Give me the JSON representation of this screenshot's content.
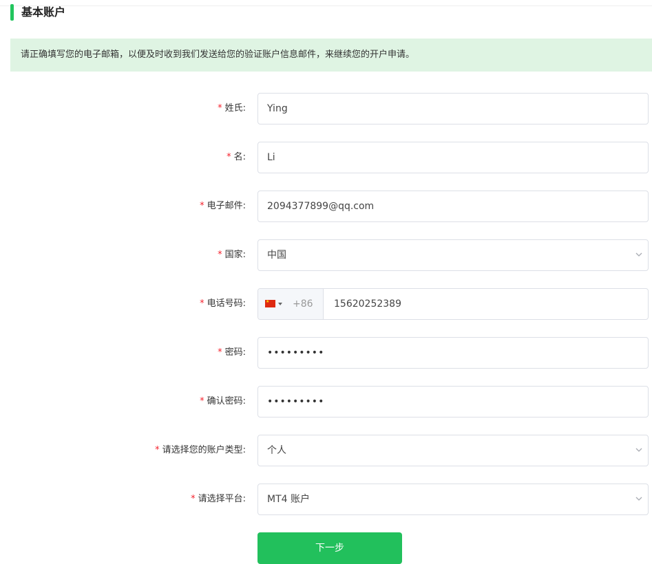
{
  "section": {
    "title": "基本账户"
  },
  "notice": {
    "text": "请正确填写您的电子邮箱，以便及时收到我们发送给您的验证账户信息邮件，来继续您的开户申请。"
  },
  "required_mark": "*",
  "form": {
    "last_name": {
      "label": "姓氏:",
      "value": "Ying"
    },
    "first_name": {
      "label": "名:",
      "value": "Li"
    },
    "email": {
      "label": "电子邮件:",
      "value": "2094377899@qq.com"
    },
    "country": {
      "label": "国家:",
      "value": "中国"
    },
    "phone": {
      "label": "电话号码:",
      "dial_code": "+86",
      "flag": "china-flag-icon",
      "value": "15620252389"
    },
    "password": {
      "label": "密码:",
      "masked": "•••••••••"
    },
    "confirm_password": {
      "label": "确认密码:",
      "masked": "•••••••••"
    },
    "account_type": {
      "label": "请选择您的账户类型:",
      "value": "个人"
    },
    "platform": {
      "label": "请选择平台:",
      "value": "MT4 账户"
    }
  },
  "next_button": {
    "label": "下一步"
  },
  "colors": {
    "accent": "#22c55e",
    "notice_bg": "#dff4e3",
    "required": "#f5222d",
    "border": "#dcdfe6"
  }
}
